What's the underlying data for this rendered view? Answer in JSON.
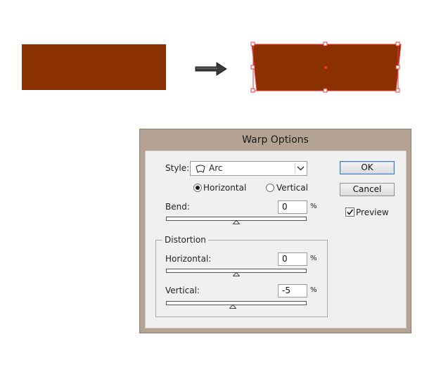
{
  "illustration": {
    "fill_color": "#8b3000",
    "selection_color": "#e8393a",
    "arrow_icon": "right-arrow-icon"
  },
  "dialog": {
    "title": "Warp Options",
    "style_label": "Style:",
    "style_value": "Arc",
    "style_icon": "arc-warp-icon",
    "orientation": {
      "horizontal_label": "Horizontal",
      "vertical_label": "Vertical",
      "selected": "Horizontal"
    },
    "bend": {
      "label": "Bend:",
      "value": "0",
      "unit": "%"
    },
    "distortion": {
      "group_label": "Distortion",
      "horizontal": {
        "label": "Horizontal:",
        "value": "0",
        "unit": "%"
      },
      "vertical": {
        "label": "Vertical:",
        "value": "-5",
        "unit": "%"
      }
    },
    "ok_label": "OK",
    "cancel_label": "Cancel",
    "preview_label": "Preview",
    "preview_checked": true
  }
}
